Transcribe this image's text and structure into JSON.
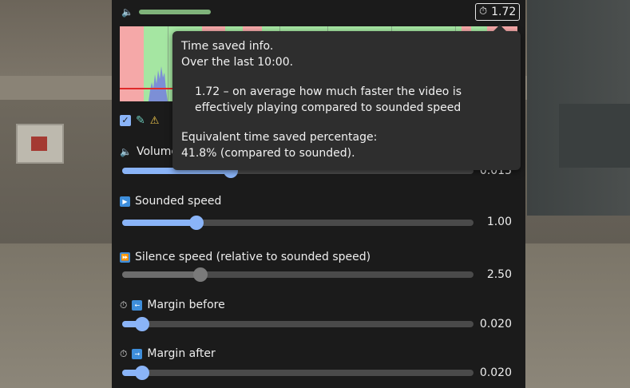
{
  "top": {
    "speed_ratio": "1.72",
    "stopwatch_icon": "stopwatch-icon",
    "volume_icon": "volume-icon",
    "volume_level": 0.25
  },
  "tooltip": {
    "line1": "Time saved info.",
    "line2": "Over the last 10:00.",
    "line3": "1.72 – on average how much faster the video is",
    "line4": "effectively playing compared to sounded speed",
    "line5": "Equivalent time saved percentage:",
    "line6": "41.8% (compared to sounded)."
  },
  "controls": {
    "volume": {
      "label": "Volume",
      "value": "0.015",
      "level": 0.31
    },
    "sounded_speed": {
      "label": "Sounded speed",
      "value": "1.00",
      "level": 0.21
    },
    "silence_speed": {
      "label": "Silence speed (relative to sounded speed)",
      "value": "2.50",
      "level": 0.22
    },
    "margin_before": {
      "label": "Margin before",
      "value": "0.020",
      "level": 0.06
    },
    "margin_after": {
      "label": "Margin after",
      "value": "0.020",
      "level": 0.06
    }
  },
  "colors": {
    "accent": "#8ab4f8",
    "silence_region": "#f5a8a8",
    "sound_region": "#a5e6a2",
    "threshold": "#e02a2a"
  }
}
